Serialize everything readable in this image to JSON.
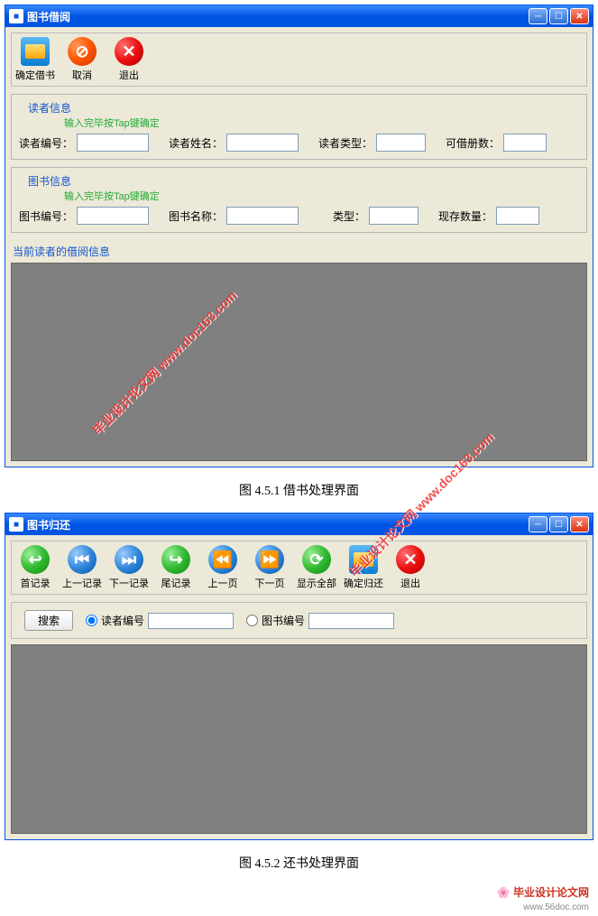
{
  "window1": {
    "title": "图书借阅",
    "toolbar": {
      "confirm": "确定借书",
      "cancel": "取消",
      "exit": "退出"
    },
    "reader": {
      "legend": "读者信息",
      "hint": "输入完毕按Tap键确定",
      "fields": {
        "id": "读者编号：",
        "name": "读者姓名：",
        "type": "读者类型：",
        "quota": "可借册数："
      }
    },
    "book": {
      "legend": "图书信息",
      "hint": "输入完毕按Tap键确定",
      "fields": {
        "id": "图书编号：",
        "name": "图书名称：",
        "type": "类型：",
        "stock": "现存数量："
      }
    },
    "grid": {
      "header": "当前读者的借阅信息"
    }
  },
  "caption1": "图 4.5.1 借书处理界面",
  "window2": {
    "title": "图书归还",
    "toolbar": {
      "first": "首记录",
      "prev": "上一记录",
      "next": "下一记录",
      "last": "尾记录",
      "prevpage": "上一页",
      "nextpage": "下一页",
      "showall": "显示全部",
      "confirm": "确定归还",
      "exit": "退出"
    },
    "search": {
      "button": "搜索",
      "radio1": "读者编号",
      "radio2": "图书编号"
    }
  },
  "caption2": "图 4.5.2 还书处理界面",
  "watermarks": {
    "text": "毕业设计论文网 www.doc163.com",
    "footer": "毕业设计论文网",
    "footer_url": "www.56doc.com"
  }
}
